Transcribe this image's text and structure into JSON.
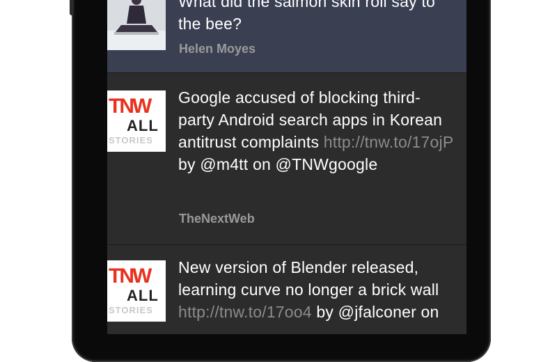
{
  "tweets": [
    {
      "text": "What did the salmon skin roll say to the bee?",
      "link": "",
      "after_link": "",
      "author": "Helen Moyes",
      "avatar": "photo-avatar"
    },
    {
      "text": "Google accused of blocking third-party Android search apps in Korean antitrust complaints ",
      "link": "http://tnw.to/17ojP",
      "after_link": " by @m4tt on @TNWgoogle",
      "author": "TheNextWeb",
      "avatar": "tnw-logo"
    },
    {
      "text": "New version of Blender released, learning curve no longer a brick wall ",
      "link": "http://tnw.to/17oo4",
      "after_link": " by @jfalconer on",
      "author": "",
      "avatar": "tnw-logo"
    }
  ],
  "logo": {
    "top": "TNW",
    "middle": "ALL",
    "bottom": "STORIES"
  },
  "colors": {
    "screen_bg": "#2c2c2c",
    "highlight_bg": "#3a3f52",
    "text": "#ffffff",
    "link": "#8c8c8c",
    "author": "#9a9a9a",
    "logo_red": "#e8321e"
  }
}
